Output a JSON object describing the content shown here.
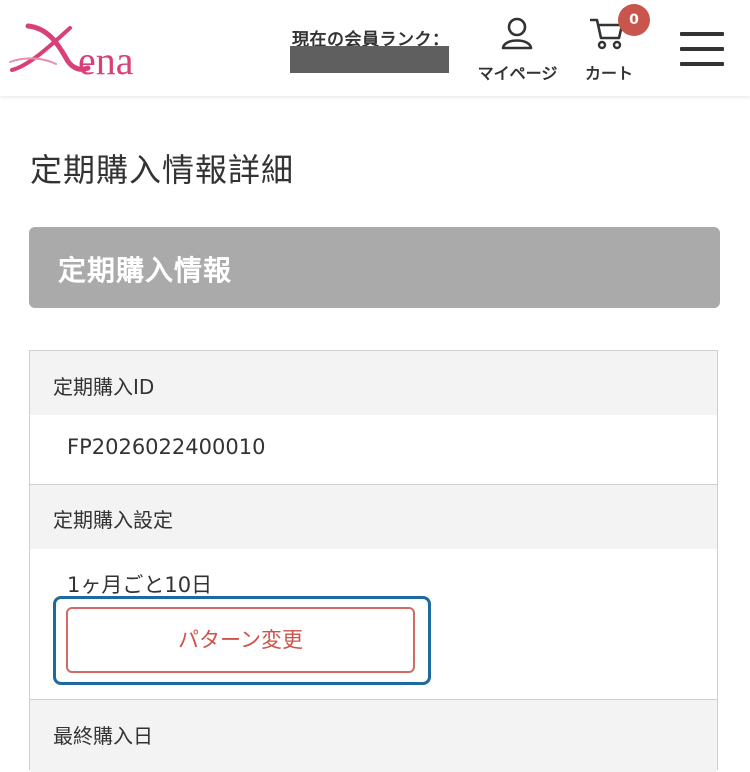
{
  "header": {
    "logo_text": "Xena",
    "member_rank_label": "現在の会員ランク：",
    "mypage_label": "マイページ",
    "cart_label": "カート",
    "cart_count": "0",
    "icons": {
      "mypage": "user-icon",
      "cart": "cart-icon",
      "menu": "hamburger-menu-icon"
    }
  },
  "main": {
    "page_title": "定期購入情報詳細",
    "section_title": "定期購入情報",
    "rows": [
      {
        "label": "定期購入ID",
        "value": "FP2026022400010"
      },
      {
        "label": "定期購入設定",
        "value": "1ヶ月ごと10日",
        "button_label": "パターン変更"
      },
      {
        "label": "最終購入日"
      }
    ]
  },
  "colors": {
    "brand_pink": "#d9407a",
    "section_header_bg": "#aaaaaa",
    "cart_badge": "#c9564d",
    "button_accent": "#d0534a",
    "focus_ring": "#1d6aa0",
    "row_head_bg": "#f3f3f3"
  }
}
